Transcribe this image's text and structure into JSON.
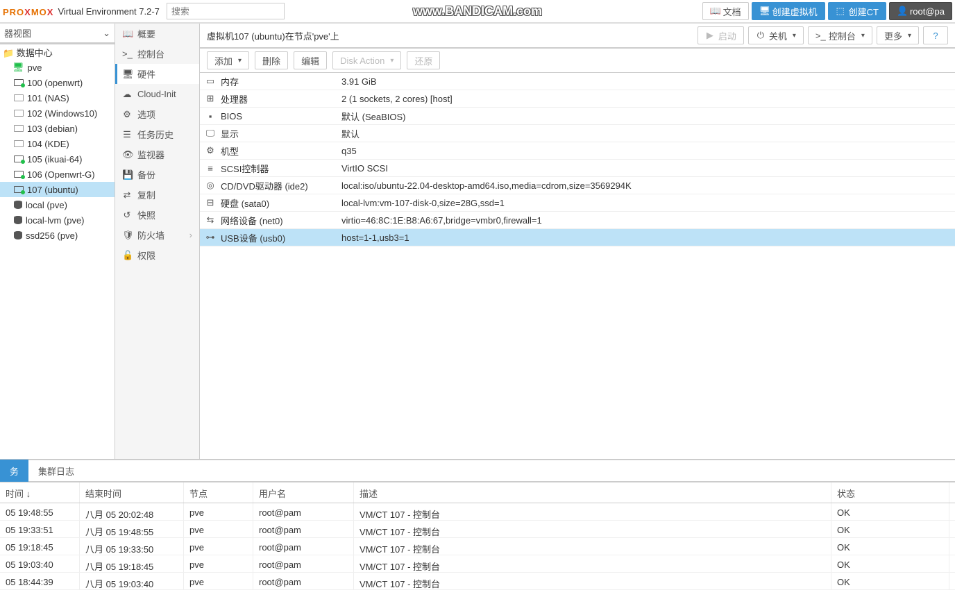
{
  "header": {
    "logo_pre": "PRO",
    "logo_post": "MO",
    "version": "Virtual Environment 7.2-7",
    "search_placeholder": "搜索",
    "watermark": "www.BANDICAM.com",
    "docs": "文档",
    "create_vm": "创建虚拟机",
    "create_ct": "创建CT",
    "user": "root@pa"
  },
  "tree": {
    "view_label": "器视图",
    "root": "数据中心",
    "node": "pve",
    "vms": [
      {
        "id": "100",
        "name": "100 (openwrt)",
        "running": true
      },
      {
        "id": "101",
        "name": "101 (NAS)",
        "running": false
      },
      {
        "id": "102",
        "name": "102 (Windows10)",
        "running": false
      },
      {
        "id": "103",
        "name": "103 (debian)",
        "running": false
      },
      {
        "id": "104",
        "name": "104 (KDE)",
        "running": false
      },
      {
        "id": "105",
        "name": "105 (ikuai-64)",
        "running": true
      },
      {
        "id": "106",
        "name": "106 (Openwrt-G)",
        "running": true
      },
      {
        "id": "107",
        "name": "107 (ubuntu)",
        "running": true,
        "selected": true
      }
    ],
    "storage": [
      "local (pve)",
      "local-lvm (pve)",
      "ssd256 (pve)"
    ]
  },
  "nav": [
    {
      "label": "概要",
      "icon": "book"
    },
    {
      "label": "控制台",
      "icon": "terminal"
    },
    {
      "label": "硬件",
      "icon": "display",
      "selected": true
    },
    {
      "label": "Cloud-Init",
      "icon": "cloud"
    },
    {
      "label": "选项",
      "icon": "gear"
    },
    {
      "label": "任务历史",
      "icon": "list"
    },
    {
      "label": "监视器",
      "icon": "eye"
    },
    {
      "label": "备份",
      "icon": "save"
    },
    {
      "label": "复制",
      "icon": "sync"
    },
    {
      "label": "快照",
      "icon": "history"
    },
    {
      "label": "防火墙",
      "icon": "shield",
      "chev": true
    },
    {
      "label": "权限",
      "icon": "lock"
    }
  ],
  "content": {
    "title": "虚拟机107 (ubuntu)在节点'pve'上",
    "actions": {
      "start": "启动",
      "shutdown": "关机",
      "console": "控制台",
      "more": "更多"
    },
    "toolbar": {
      "add": "添加",
      "remove": "删除",
      "edit": "编辑",
      "disk_action": "Disk Action",
      "revert": "还原"
    },
    "rows": [
      {
        "icon": "mem",
        "label": "内存",
        "value": "3.91 GiB"
      },
      {
        "icon": "cpu",
        "label": "处理器",
        "value": "2 (1 sockets, 2 cores) [host]"
      },
      {
        "icon": "bios",
        "label": "BIOS",
        "value": "默认 (SeaBIOS)"
      },
      {
        "icon": "disp",
        "label": "显示",
        "value": "默认"
      },
      {
        "icon": "mach",
        "label": "机型",
        "value": "q35"
      },
      {
        "icon": "scsi",
        "label": "SCSI控制器",
        "value": "VirtIO SCSI"
      },
      {
        "icon": "cd",
        "label": "CD/DVD驱动器 (ide2)",
        "value": "local:iso/ubuntu-22.04-desktop-amd64.iso,media=cdrom,size=3569294K"
      },
      {
        "icon": "hdd",
        "label": "硬盘 (sata0)",
        "value": "local-lvm:vm-107-disk-0,size=28G,ssd=1"
      },
      {
        "icon": "net",
        "label": "网络设备 (net0)",
        "value": "virtio=46:8C:1E:B8:A6:67,bridge=vmbr0,firewall=1"
      },
      {
        "icon": "usb",
        "label": "USB设备 (usb0)",
        "value": "host=1-1,usb3=1",
        "selected": true
      }
    ]
  },
  "log": {
    "tabs": [
      "务",
      "集群日志"
    ],
    "columns": [
      "时间 ↓",
      "结束时间",
      "节点",
      "用户名",
      "描述",
      "状态"
    ],
    "rows": [
      {
        "t1": "05 19:48:55",
        "t2": "八月 05 20:02:48",
        "node": "pve",
        "user": "root@pam",
        "desc": "VM/CT 107 - 控制台",
        "status": "OK"
      },
      {
        "t1": "05 19:33:51",
        "t2": "八月 05 19:48:55",
        "node": "pve",
        "user": "root@pam",
        "desc": "VM/CT 107 - 控制台",
        "status": "OK"
      },
      {
        "t1": "05 19:18:45",
        "t2": "八月 05 19:33:50",
        "node": "pve",
        "user": "root@pam",
        "desc": "VM/CT 107 - 控制台",
        "status": "OK"
      },
      {
        "t1": "05 19:03:40",
        "t2": "八月 05 19:18:45",
        "node": "pve",
        "user": "root@pam",
        "desc": "VM/CT 107 - 控制台",
        "status": "OK"
      },
      {
        "t1": "05 18:44:39",
        "t2": "八月 05 19:03:40",
        "node": "pve",
        "user": "root@pam",
        "desc": "VM/CT 107 - 控制台",
        "status": "OK"
      }
    ]
  }
}
